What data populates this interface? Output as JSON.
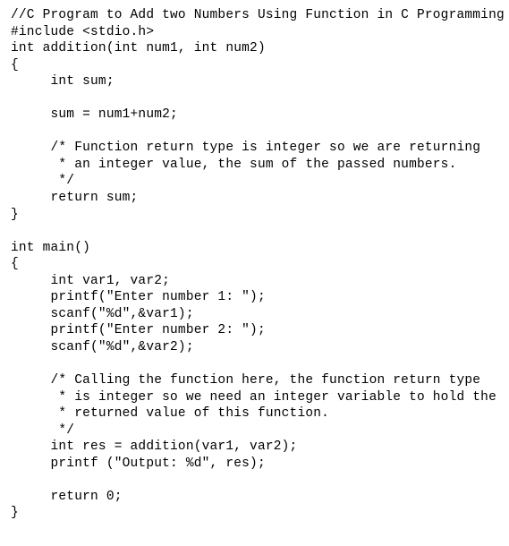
{
  "code": {
    "lines": [
      "//C Program to Add two Numbers Using Function in C Programming",
      "#include <stdio.h>",
      "int addition(int num1, int num2)",
      "{",
      "     int sum;",
      "",
      "     sum = num1+num2;",
      "",
      "     /* Function return type is integer so we are returning",
      "      * an integer value, the sum of the passed numbers.",
      "      */",
      "     return sum;",
      "}",
      "",
      "int main()",
      "{",
      "     int var1, var2;",
      "     printf(\"Enter number 1: \");",
      "     scanf(\"%d\",&var1);",
      "     printf(\"Enter number 2: \");",
      "     scanf(\"%d\",&var2);",
      "",
      "     /* Calling the function here, the function return type",
      "      * is integer so we need an integer variable to hold the",
      "      * returned value of this function.",
      "      */",
      "     int res = addition(var1, var2);",
      "     printf (\"Output: %d\", res);",
      "",
      "     return 0;",
      "}"
    ]
  }
}
